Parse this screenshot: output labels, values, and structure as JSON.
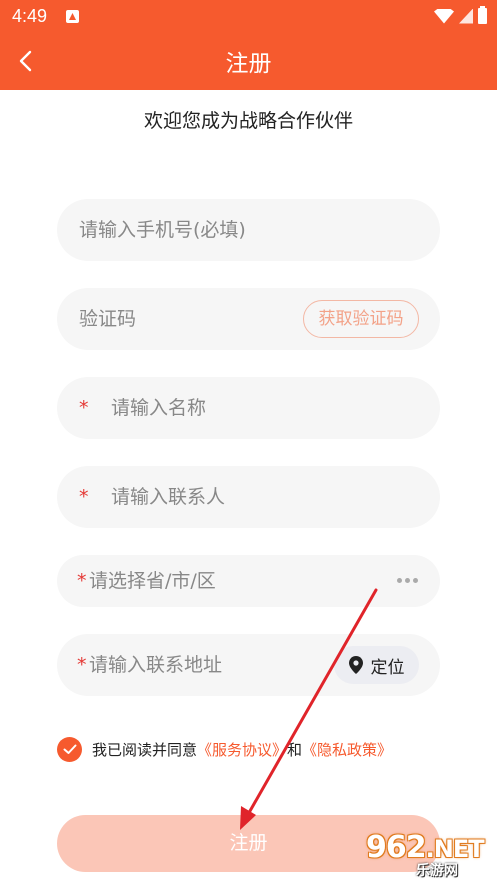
{
  "status_bar": {
    "time": "4:49"
  },
  "header": {
    "title": "注册"
  },
  "welcome": "欢迎您成为战略合作伙伴",
  "form": {
    "phone_placeholder": "请输入手机号(必填)",
    "code_placeholder": "验证码",
    "get_code_label": "获取验证码",
    "name_required_mark": "*",
    "name_placeholder": "请输入名称",
    "contact_required_mark": "*",
    "contact_placeholder": "请输入联系人",
    "region_required_mark": "*",
    "region_placeholder": "请选择省/市/区",
    "address_required_mark": "*",
    "address_placeholder": "请输入联系地址",
    "locate_label": "定位"
  },
  "agreement": {
    "prefix": "我已阅读并同意",
    "service_link": "《服务协议》",
    "and": "和",
    "privacy_link": "《隐私政策》"
  },
  "register_button": "注册",
  "watermark": {
    "main": "962",
    "suffix": ".NET",
    "sub": "乐游网"
  },
  "colors": {
    "primary": "#f65a2e",
    "field_bg": "#f6f6f6",
    "button_disabled": "#fbc6b7",
    "required": "#e53935",
    "annotation_arrow": "#e0242a"
  }
}
